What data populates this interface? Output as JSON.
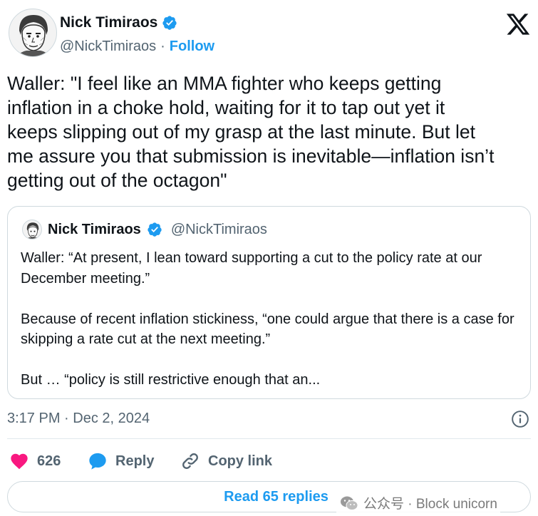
{
  "author": {
    "name": "Nick Timiraos",
    "handle": "@NickTimiraos",
    "separator": "·",
    "follow_label": "Follow"
  },
  "tweet": {
    "text": "Waller: \"I feel like an MMA fighter who keeps getting\ninflation in a choke hold, waiting for it to tap out yet it\nkeeps slipping out of my grasp at the last minute. But let\nme assure you that submission is inevitable—inflation isn’t\ngetting out of the octagon\"",
    "timestamp": "3:17 PM · Dec 2, 2024"
  },
  "quoted": {
    "name": "Nick Timiraos",
    "handle": "@NickTimiraos",
    "paragraphs": [
      "Waller: “At present, I lean toward supporting a cut to the policy rate at our December meeting.”",
      "Because of recent inflation stickiness, “one could argue that there is a case for skipping a rate cut at the next meeting.”",
      "But … “policy is still restrictive enough that an..."
    ]
  },
  "actions": {
    "like_count": "626",
    "reply_label": "Reply",
    "copy_link_label": "Copy link"
  },
  "read_replies_label": "Read 65 replies",
  "watermark": {
    "text": "公众号 · Block unicorn"
  },
  "colors": {
    "accent": "#1d9bf0",
    "like": "#f91880",
    "text": "#0f1419",
    "muted": "#536471",
    "border": "#cfd9de"
  },
  "icons": [
    "verified-badge-icon",
    "x-logo-icon",
    "info-icon",
    "heart-icon",
    "reply-bubble-icon",
    "link-icon",
    "wechat-icon"
  ]
}
